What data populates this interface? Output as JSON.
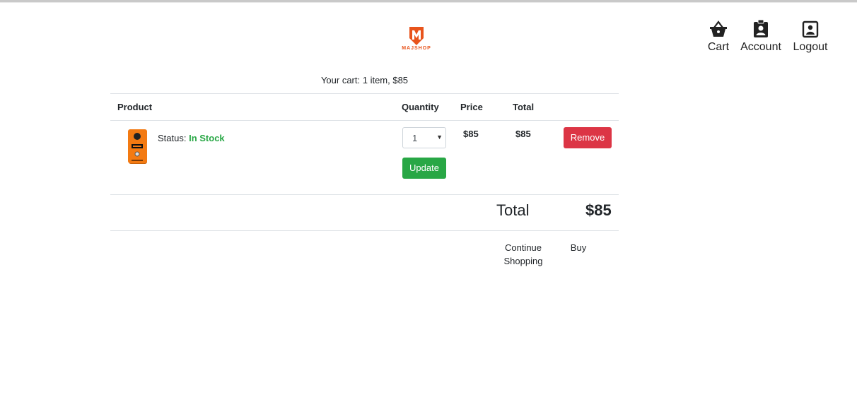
{
  "brand": {
    "name": "MAJSHOP",
    "color": "#e8541c"
  },
  "nav": {
    "cart": {
      "label": "Cart",
      "icon": "basket-icon"
    },
    "account": {
      "label": "Account",
      "icon": "id-badge-icon"
    },
    "logout": {
      "label": "Logout",
      "icon": "user-square-icon"
    }
  },
  "cart": {
    "summary": "Your cart: 1 item, $85",
    "headers": {
      "product": "Product",
      "quantity": "Quantity",
      "price": "Price",
      "total": "Total"
    },
    "items": [
      {
        "image_icon": "guitar-pedal-icon",
        "status_label": "Status:",
        "status_value": "In Stock",
        "quantity": "1",
        "price": "$85",
        "total": "$85",
        "update_label": "Update",
        "remove_label": "Remove"
      }
    ],
    "total_label": "Total",
    "total_value": "$85",
    "continue_label": "Continue Shopping",
    "buy_label": "Buy"
  },
  "colors": {
    "success": "#28a745",
    "danger": "#dc3545",
    "text": "#212529"
  }
}
